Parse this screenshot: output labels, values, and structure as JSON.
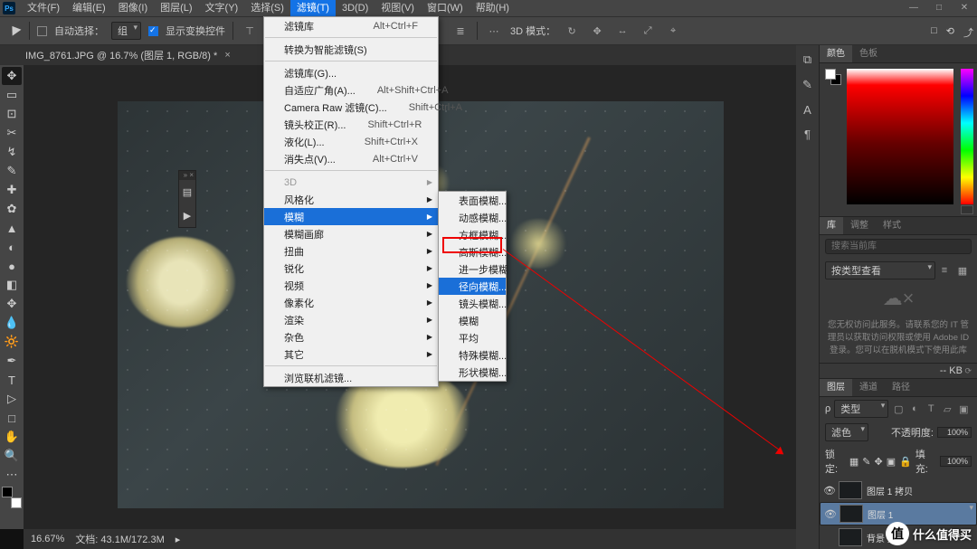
{
  "menubar": {
    "items": [
      "文件(F)",
      "编辑(E)",
      "图像(I)",
      "图层(L)",
      "文字(Y)",
      "选择(S)",
      "滤镜(T)",
      "3D(D)",
      "视图(V)",
      "窗口(W)",
      "帮助(H)"
    ],
    "open_index": 6,
    "logo": "Ps"
  },
  "window_buttons": {
    "min": "—",
    "max": "□",
    "close": "✕"
  },
  "options": {
    "auto_select": "自动选择：",
    "group": "组",
    "show_transform": "显示变换控件",
    "mode_3d": "3D 模式："
  },
  "topright_icons": [
    "□",
    "⟲",
    "⤴"
  ],
  "doc_tab": {
    "title": "IMG_8761.JPG @ 16.7% (图层 1, RGB/8) *"
  },
  "tools": [
    "✥",
    "▭",
    "⊡",
    "✂",
    "↯",
    "✎",
    "✚",
    "✿",
    "▲",
    "◐",
    "●",
    "◧",
    "✥",
    "T",
    "▷",
    "□",
    "✋",
    "🔍",
    "⋯"
  ],
  "filter_menu": {
    "rows": [
      {
        "label": "滤镜库",
        "shortcut": "Alt+Ctrl+F"
      },
      {
        "sep": true
      },
      {
        "label": "转换为智能滤镜(S)"
      },
      {
        "sep": true
      },
      {
        "label": "滤镜库(G)..."
      },
      {
        "label": "自适应广角(A)...",
        "shortcut": "Alt+Shift+Ctrl+A"
      },
      {
        "label": "Camera Raw 滤镜(C)...",
        "shortcut": "Shift+Ctrl+A"
      },
      {
        "label": "镜头校正(R)...",
        "shortcut": "Shift+Ctrl+R"
      },
      {
        "label": "液化(L)...",
        "shortcut": "Shift+Ctrl+X"
      },
      {
        "label": "消失点(V)...",
        "shortcut": "Alt+Ctrl+V"
      },
      {
        "sep": true
      },
      {
        "label": "3D",
        "sub": true,
        "disabled": true
      },
      {
        "label": "风格化",
        "sub": true
      },
      {
        "label": "模糊",
        "sub": true,
        "hl": true
      },
      {
        "label": "模糊画廊",
        "sub": true
      },
      {
        "label": "扭曲",
        "sub": true
      },
      {
        "label": "锐化",
        "sub": true
      },
      {
        "label": "视频",
        "sub": true
      },
      {
        "label": "像素化",
        "sub": true
      },
      {
        "label": "渲染",
        "sub": true
      },
      {
        "label": "杂色",
        "sub": true
      },
      {
        "label": "其它",
        "sub": true
      },
      {
        "sep": true
      },
      {
        "label": "浏览联机滤镜..."
      }
    ]
  },
  "blur_submenu": {
    "rows": [
      {
        "label": "表面模糊..."
      },
      {
        "label": "动感模糊..."
      },
      {
        "label": "方框模糊..."
      },
      {
        "label": "高斯模糊..."
      },
      {
        "label": "进一步模糊"
      },
      {
        "label": "径向模糊...",
        "hl": true
      },
      {
        "label": "镜头模糊..."
      },
      {
        "label": "模糊"
      },
      {
        "label": "平均"
      },
      {
        "label": "特殊模糊..."
      },
      {
        "label": "形状模糊..."
      }
    ]
  },
  "panels": {
    "color_tabs": [
      "颜色",
      "色板"
    ],
    "lib_tabs": [
      "库",
      "调整",
      "样式"
    ],
    "search_placeholder": "搜索当前库",
    "lib_select": "按类型查看",
    "cloud_msg": "您无权访问此服务。请联系您的 IT 管理员以获取访问权限或使用 Adobe ID 登录。您可以在脱机模式下使用此库",
    "kb": "-- KB",
    "layer_tabs": [
      "图层",
      "通道",
      "路径"
    ],
    "kind": "类型",
    "blend": "滤色",
    "opacity_label": "不透明度:",
    "opacity": "100%",
    "lock": "锁定:",
    "fill_label": "填充:",
    "fill": "100%",
    "layers": [
      {
        "name": "图层 1 拷贝",
        "eye": true
      },
      {
        "name": "图层 1",
        "eye": true,
        "sel": true
      },
      {
        "name": "背景 拷贝",
        "eye": false
      }
    ]
  },
  "status": {
    "zoom": "16.67%",
    "doc": "文档: 43.1M/172.3M"
  },
  "watermark": {
    "badge": "值",
    "text": "什么值得买"
  }
}
